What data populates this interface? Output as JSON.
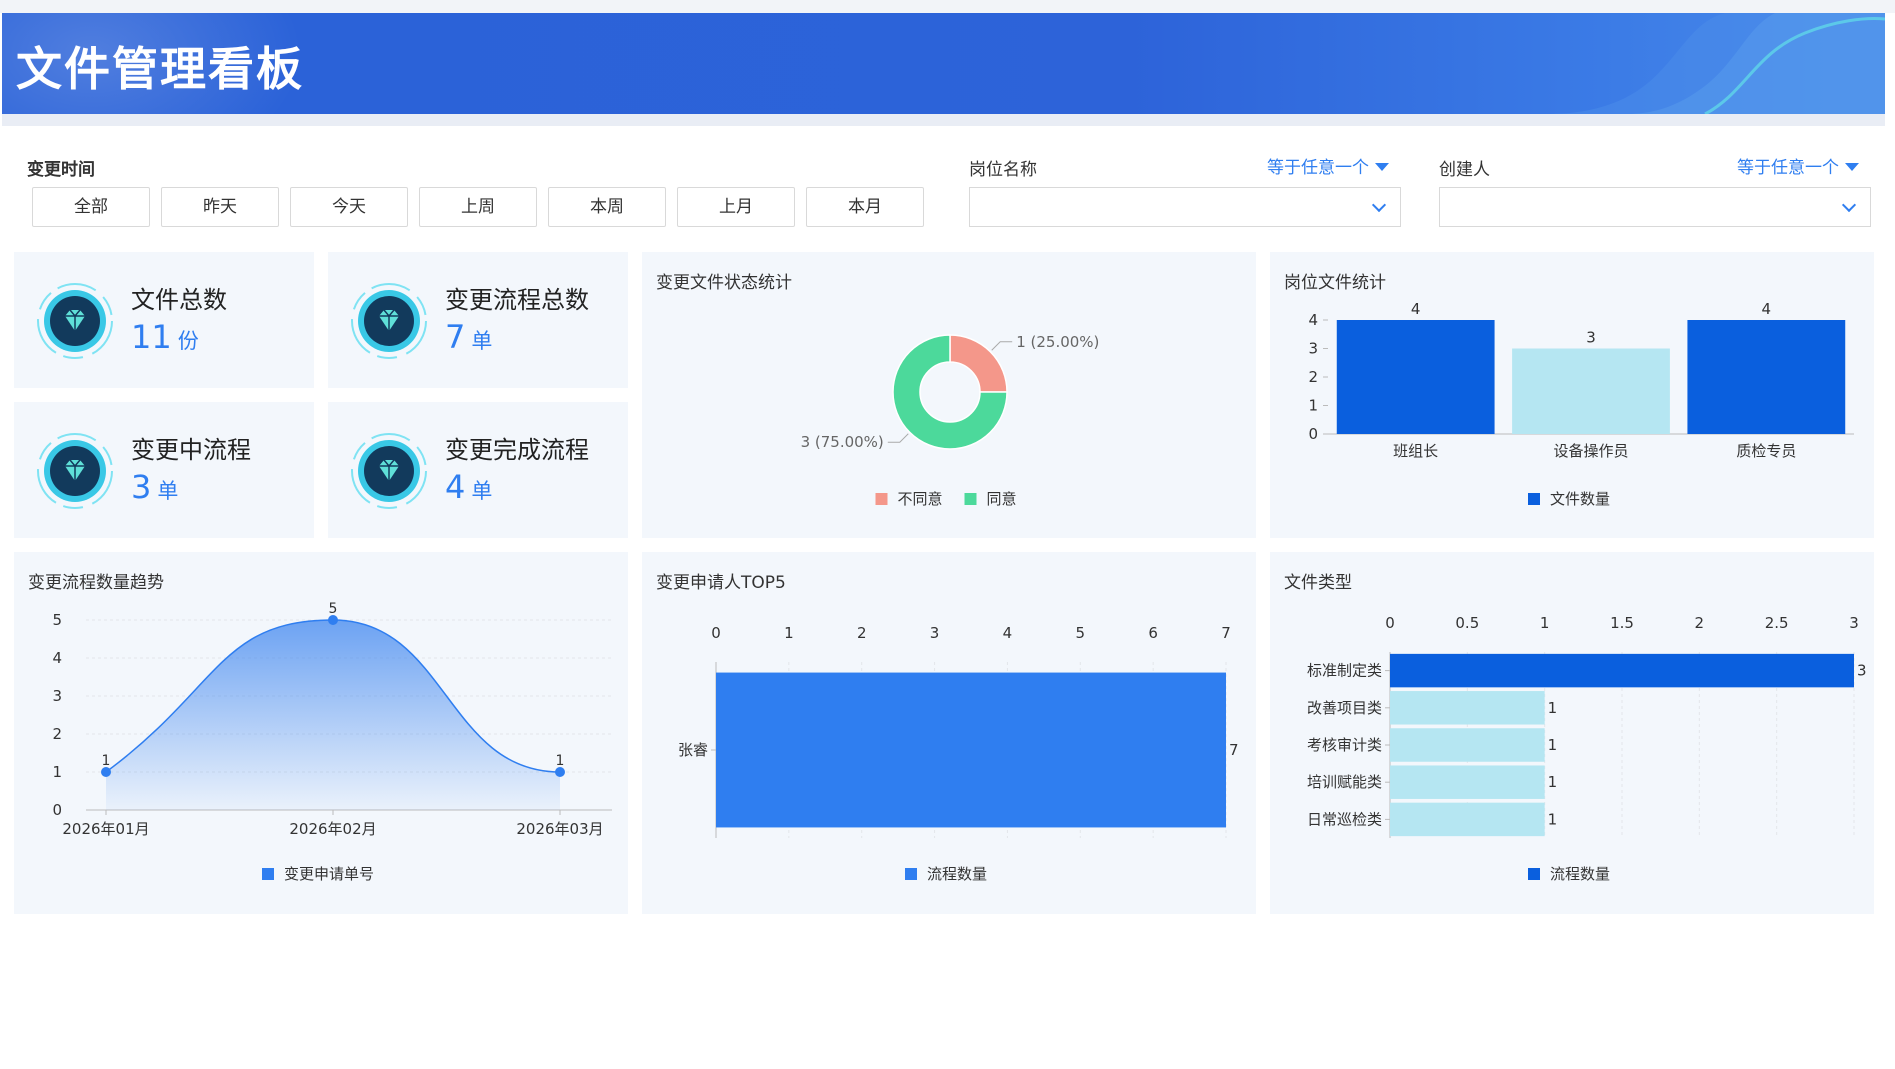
{
  "header": {
    "title": "文件管理看板"
  },
  "filters": {
    "time_label": "变更时间",
    "time_buttons": [
      "全部",
      "昨天",
      "今天",
      "上周",
      "本周",
      "上月",
      "本月"
    ],
    "position_label": "岗位名称",
    "position_op": "等于任意一个",
    "position_value": "",
    "creator_label": "创建人",
    "creator_op": "等于任意一个",
    "creator_value": ""
  },
  "kpis": [
    {
      "label": "文件总数",
      "value": "11",
      "unit": "份"
    },
    {
      "label": "变更流程总数",
      "value": "7",
      "unit": "单"
    },
    {
      "label": "变更中流程",
      "value": "3",
      "unit": "单"
    },
    {
      "label": "变更完成流程",
      "value": "4",
      "unit": "单"
    }
  ],
  "colors": {
    "accent": "#2f7ef0",
    "header": "#2d63d9",
    "card_bg": "#f3f7fc"
  },
  "chart_data": [
    {
      "type": "pie",
      "title": "变更文件状态统计",
      "slices": [
        {
          "name": "不同意",
          "value": 1,
          "label": "1 (25.00%)",
          "color": "#f4978a"
        },
        {
          "name": "同意",
          "value": 3,
          "label": "3 (75.00%)",
          "color": "#4cd99b"
        }
      ],
      "legend": "bottom"
    },
    {
      "type": "bar",
      "title": "岗位文件统计",
      "categories": [
        "班组长",
        "设备操作员",
        "质检专员"
      ],
      "series": [
        {
          "name": "文件数量",
          "values": [
            4,
            3,
            4
          ]
        }
      ],
      "ylim": [
        0,
        4
      ],
      "yticks": [
        "0",
        "1",
        "2",
        "3",
        "4"
      ],
      "bar_colors": [
        "#0a5fde",
        "#b5e6f2",
        "#0a5fde"
      ],
      "legend": "bottom"
    },
    {
      "type": "area",
      "title": "变更流程数量趋势",
      "categories": [
        "2026年01月",
        "2026年02月",
        "2026年03月"
      ],
      "series": [
        {
          "name": "变更申请单号",
          "values": [
            1,
            5,
            1
          ]
        }
      ],
      "ylim": [
        0,
        5
      ],
      "yticks": [
        "0",
        "1",
        "2",
        "3",
        "4",
        "5"
      ],
      "legend": "bottom"
    },
    {
      "type": "bar",
      "orientation": "horizontal",
      "title": "变更申请人TOP5",
      "categories": [
        "张睿"
      ],
      "series": [
        {
          "name": "流程数量",
          "values": [
            7
          ]
        }
      ],
      "xlim": [
        0,
        7
      ],
      "xticks": [
        "0",
        "1",
        "2",
        "3",
        "4",
        "5",
        "6",
        "7"
      ],
      "legend": "bottom"
    },
    {
      "type": "bar",
      "orientation": "horizontal",
      "title": "文件类型",
      "categories": [
        "标准制定类",
        "改善项目类",
        "考核审计类",
        "培训赋能类",
        "日常巡检类"
      ],
      "series": [
        {
          "name": "流程数量",
          "values": [
            3,
            1,
            1,
            1,
            1
          ]
        }
      ],
      "xlim": [
        0,
        3
      ],
      "xticks": [
        "0",
        "0.5",
        "1",
        "1.5",
        "2",
        "2.5",
        "3"
      ],
      "bar_colors": [
        "#0a5fde",
        "#b5e6f2",
        "#b5e6f2",
        "#b5e6f2",
        "#b5e6f2"
      ],
      "legend": "bottom"
    }
  ]
}
